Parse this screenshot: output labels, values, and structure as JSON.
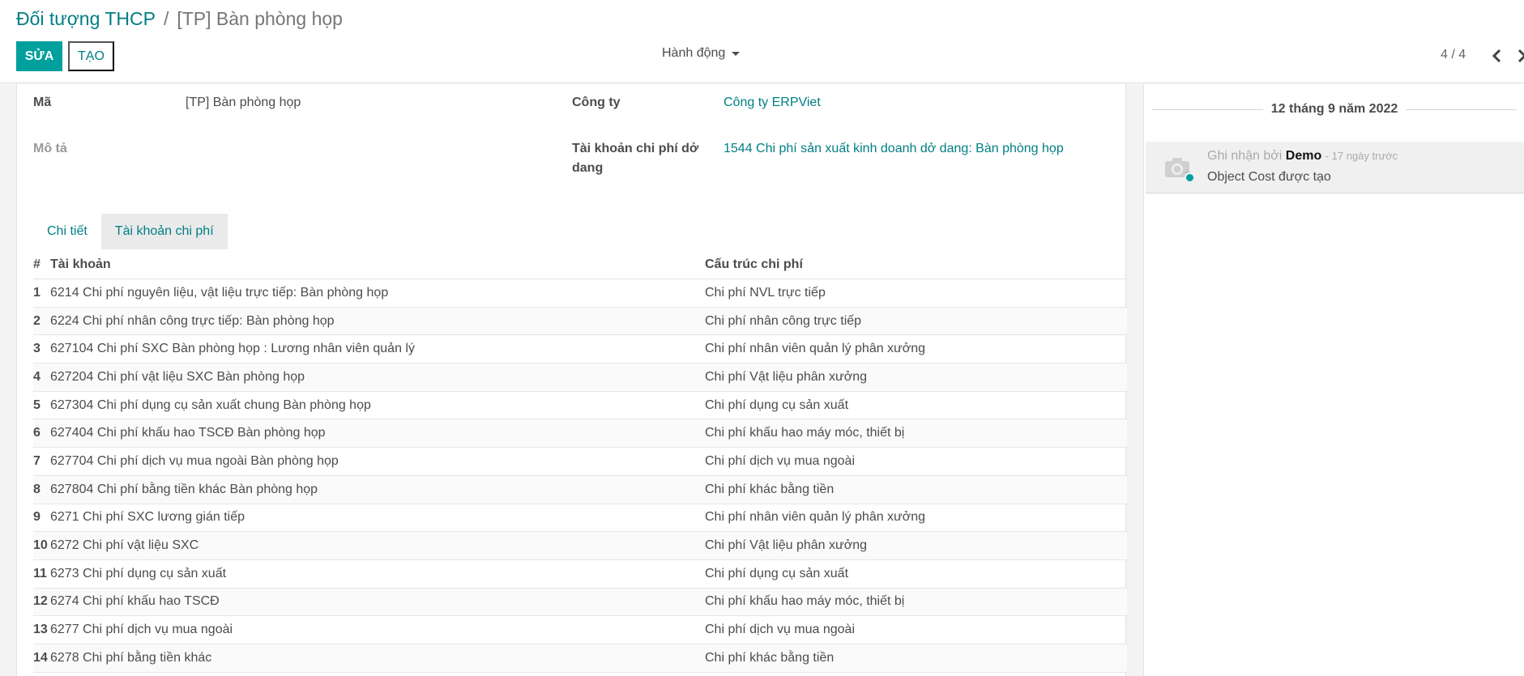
{
  "breadcrumb": {
    "parent": "Đối tượng THCP",
    "separator": "/",
    "current": "[TP] Bàn phòng họp"
  },
  "toolbar": {
    "edit_label": "SỬA",
    "create_label": "TẠO",
    "action_label": "Hành động",
    "pager_text": "4 / 4"
  },
  "form": {
    "code_label": "Mã",
    "code_value": "[TP] Bàn phòng họp",
    "company_label": "Công ty",
    "company_value": "Công ty ERPViet",
    "description_label": "Mô tả",
    "wip_account_label_line1": "Tài khoản chi phí dở",
    "wip_account_label_line2": "dang",
    "wip_account_value": "1544 Chi phí sản xuất kinh doanh dở dang: Bàn phòng họp"
  },
  "tabs": [
    {
      "label": "Chi tiết"
    },
    {
      "label": "Tài khoản chi phí"
    }
  ],
  "table": {
    "headers": {
      "num": "#",
      "account": "Tài khoản",
      "cost_structure": "Cấu trúc chi phí"
    },
    "rows": [
      {
        "num": "1",
        "account": "6214 Chi phí nguyên liệu, vật liệu trực tiếp: Bàn phòng họp",
        "cost": "Chi phí NVL trực tiếp"
      },
      {
        "num": "2",
        "account": "6224 Chi phí nhân công trực tiếp: Bàn phòng họp",
        "cost": "Chi phí nhân công trực tiếp"
      },
      {
        "num": "3",
        "account": "627104 Chi phí SXC Bàn phòng họp : Lương nhân viên quản lý",
        "cost": "Chi phí nhân viên quản lý phân xưởng"
      },
      {
        "num": "4",
        "account": "627204 Chi phí vật liệu SXC Bàn phòng họp",
        "cost": "Chi phí Vật liệu phân xưởng"
      },
      {
        "num": "5",
        "account": "627304 Chi phí dụng cụ sản xuất chung Bàn phòng họp",
        "cost": "Chi phí dụng cụ sản xuất"
      },
      {
        "num": "6",
        "account": "627404 Chi phí khấu hao TSCĐ Bàn phòng họp",
        "cost": "Chi phí khấu hao máy móc, thiết bị"
      },
      {
        "num": "7",
        "account": "627704 Chi phí dịch vụ mua ngoài Bàn phòng họp",
        "cost": "Chi phí dịch vụ mua ngoài"
      },
      {
        "num": "8",
        "account": "627804 Chi phí bằng tiền khác Bàn phòng họp",
        "cost": "Chi phí khác bằng tiền"
      },
      {
        "num": "9",
        "account": "6271 Chi phí SXC lương gián tiếp",
        "cost": "Chi phí nhân viên quản lý phân xưởng"
      },
      {
        "num": "10",
        "account": "6272 Chi phí vật liệu SXC",
        "cost": "Chi phí Vật liệu phân xưởng"
      },
      {
        "num": "11",
        "account": "6273 Chi phí dụng cụ sản xuất",
        "cost": "Chi phí dụng cụ sản xuất"
      },
      {
        "num": "12",
        "account": "6274 Chi phí khấu hao TSCĐ",
        "cost": "Chi phí khấu hao máy móc, thiết bị"
      },
      {
        "num": "13",
        "account": "6277 Chi phí dịch vụ mua ngoài",
        "cost": "Chi phí dịch vụ mua ngoài"
      },
      {
        "num": "14",
        "account": "6278 Chi phí bằng tiền khác",
        "cost": "Chi phí khác bằng tiền"
      }
    ]
  },
  "chatter": {
    "date_separator": "12 tháng 9 năm 2022",
    "message": {
      "prefix": "Ghi nhận bởi",
      "author": "Demo",
      "ago": "- 17 ngày trước",
      "body": "Object Cost được tạo"
    }
  },
  "colors": {
    "primary": "#00a09d",
    "link": "#017e84"
  },
  "icons": {
    "pager_prev": "chevron-left-icon",
    "pager_next": "chevron-right-icon",
    "avatar": "camera-icon",
    "action_caret": "caret-down-icon"
  }
}
